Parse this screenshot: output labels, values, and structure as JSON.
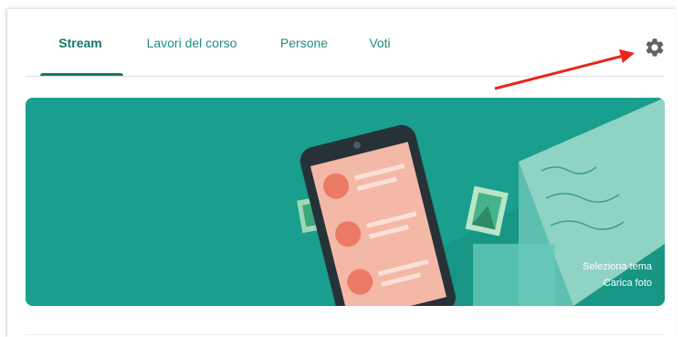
{
  "tabs": [
    {
      "label": "Stream",
      "active": true
    },
    {
      "label": "Lavori del corso",
      "active": false
    },
    {
      "label": "Persone",
      "active": false
    },
    {
      "label": "Voti",
      "active": false
    }
  ],
  "header": {
    "settings_icon": "gear-icon"
  },
  "annotation": {
    "arrow_color": "#e8261b"
  },
  "banner": {
    "background_color": "#1a9e8e",
    "select_theme_label": "Seleziona tema",
    "upload_photo_label": "Carica foto"
  },
  "colors": {
    "accent": "#127a6c",
    "tab_text": "#1e8e7e"
  }
}
